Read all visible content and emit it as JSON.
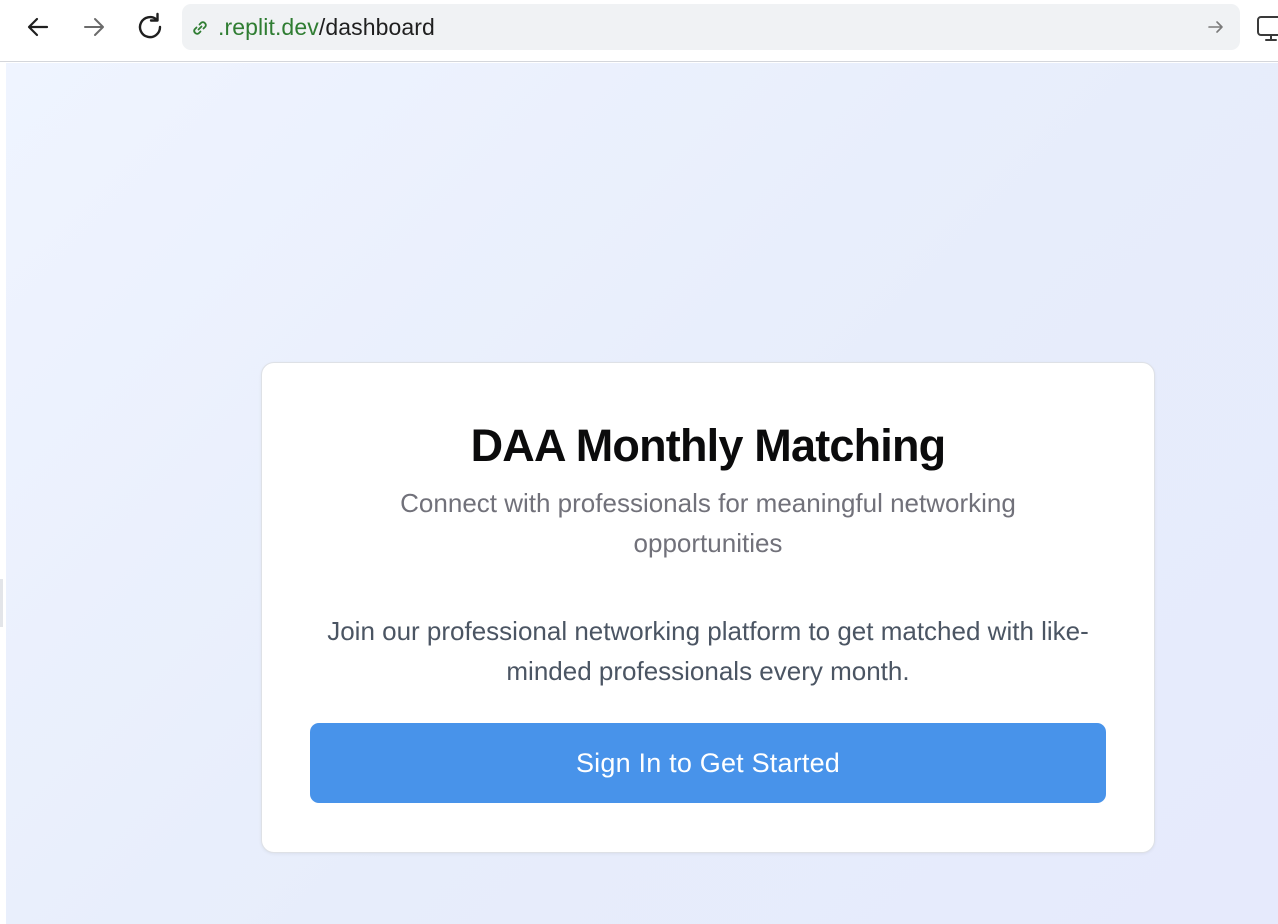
{
  "browser": {
    "url_domain": ".replit.dev",
    "url_path": "/dashboard",
    "icons": {
      "back": "back-arrow-icon",
      "forward": "forward-arrow-icon",
      "reload": "reload-icon",
      "link": "link-icon",
      "go": "go-arrow-icon",
      "monitor": "monitor-icon"
    }
  },
  "card": {
    "title": "DAA Monthly Matching",
    "subtitle": "Connect with professionals for meaningful networking opportunities",
    "description": "Join our professional networking platform to get matched with like-minded professionals every month.",
    "cta_label": "Sign In to Get Started"
  },
  "colors": {
    "accent": "#4893ea",
    "url_domain": "#2f7d32",
    "title": "#0b0b0c",
    "subtitle": "#71717a",
    "description": "#4b5563"
  }
}
